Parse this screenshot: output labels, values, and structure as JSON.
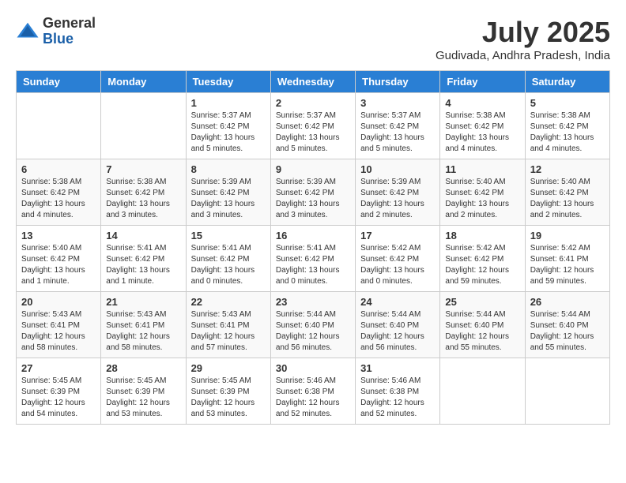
{
  "header": {
    "logo_general": "General",
    "logo_blue": "Blue",
    "month_title": "July 2025",
    "location": "Gudivada, Andhra Pradesh, India"
  },
  "weekdays": [
    "Sunday",
    "Monday",
    "Tuesday",
    "Wednesday",
    "Thursday",
    "Friday",
    "Saturday"
  ],
  "weeks": [
    [
      {
        "day": "",
        "sunrise": "",
        "sunset": "",
        "daylight": ""
      },
      {
        "day": "",
        "sunrise": "",
        "sunset": "",
        "daylight": ""
      },
      {
        "day": "1",
        "sunrise": "Sunrise: 5:37 AM",
        "sunset": "Sunset: 6:42 PM",
        "daylight": "Daylight: 13 hours and 5 minutes."
      },
      {
        "day": "2",
        "sunrise": "Sunrise: 5:37 AM",
        "sunset": "Sunset: 6:42 PM",
        "daylight": "Daylight: 13 hours and 5 minutes."
      },
      {
        "day": "3",
        "sunrise": "Sunrise: 5:37 AM",
        "sunset": "Sunset: 6:42 PM",
        "daylight": "Daylight: 13 hours and 5 minutes."
      },
      {
        "day": "4",
        "sunrise": "Sunrise: 5:38 AM",
        "sunset": "Sunset: 6:42 PM",
        "daylight": "Daylight: 13 hours and 4 minutes."
      },
      {
        "day": "5",
        "sunrise": "Sunrise: 5:38 AM",
        "sunset": "Sunset: 6:42 PM",
        "daylight": "Daylight: 13 hours and 4 minutes."
      }
    ],
    [
      {
        "day": "6",
        "sunrise": "Sunrise: 5:38 AM",
        "sunset": "Sunset: 6:42 PM",
        "daylight": "Daylight: 13 hours and 4 minutes."
      },
      {
        "day": "7",
        "sunrise": "Sunrise: 5:38 AM",
        "sunset": "Sunset: 6:42 PM",
        "daylight": "Daylight: 13 hours and 3 minutes."
      },
      {
        "day": "8",
        "sunrise": "Sunrise: 5:39 AM",
        "sunset": "Sunset: 6:42 PM",
        "daylight": "Daylight: 13 hours and 3 minutes."
      },
      {
        "day": "9",
        "sunrise": "Sunrise: 5:39 AM",
        "sunset": "Sunset: 6:42 PM",
        "daylight": "Daylight: 13 hours and 3 minutes."
      },
      {
        "day": "10",
        "sunrise": "Sunrise: 5:39 AM",
        "sunset": "Sunset: 6:42 PM",
        "daylight": "Daylight: 13 hours and 2 minutes."
      },
      {
        "day": "11",
        "sunrise": "Sunrise: 5:40 AM",
        "sunset": "Sunset: 6:42 PM",
        "daylight": "Daylight: 13 hours and 2 minutes."
      },
      {
        "day": "12",
        "sunrise": "Sunrise: 5:40 AM",
        "sunset": "Sunset: 6:42 PM",
        "daylight": "Daylight: 13 hours and 2 minutes."
      }
    ],
    [
      {
        "day": "13",
        "sunrise": "Sunrise: 5:40 AM",
        "sunset": "Sunset: 6:42 PM",
        "daylight": "Daylight: 13 hours and 1 minute."
      },
      {
        "day": "14",
        "sunrise": "Sunrise: 5:41 AM",
        "sunset": "Sunset: 6:42 PM",
        "daylight": "Daylight: 13 hours and 1 minute."
      },
      {
        "day": "15",
        "sunrise": "Sunrise: 5:41 AM",
        "sunset": "Sunset: 6:42 PM",
        "daylight": "Daylight: 13 hours and 0 minutes."
      },
      {
        "day": "16",
        "sunrise": "Sunrise: 5:41 AM",
        "sunset": "Sunset: 6:42 PM",
        "daylight": "Daylight: 13 hours and 0 minutes."
      },
      {
        "day": "17",
        "sunrise": "Sunrise: 5:42 AM",
        "sunset": "Sunset: 6:42 PM",
        "daylight": "Daylight: 13 hours and 0 minutes."
      },
      {
        "day": "18",
        "sunrise": "Sunrise: 5:42 AM",
        "sunset": "Sunset: 6:42 PM",
        "daylight": "Daylight: 12 hours and 59 minutes."
      },
      {
        "day": "19",
        "sunrise": "Sunrise: 5:42 AM",
        "sunset": "Sunset: 6:41 PM",
        "daylight": "Daylight: 12 hours and 59 minutes."
      }
    ],
    [
      {
        "day": "20",
        "sunrise": "Sunrise: 5:43 AM",
        "sunset": "Sunset: 6:41 PM",
        "daylight": "Daylight: 12 hours and 58 minutes."
      },
      {
        "day": "21",
        "sunrise": "Sunrise: 5:43 AM",
        "sunset": "Sunset: 6:41 PM",
        "daylight": "Daylight: 12 hours and 58 minutes."
      },
      {
        "day": "22",
        "sunrise": "Sunrise: 5:43 AM",
        "sunset": "Sunset: 6:41 PM",
        "daylight": "Daylight: 12 hours and 57 minutes."
      },
      {
        "day": "23",
        "sunrise": "Sunrise: 5:44 AM",
        "sunset": "Sunset: 6:40 PM",
        "daylight": "Daylight: 12 hours and 56 minutes."
      },
      {
        "day": "24",
        "sunrise": "Sunrise: 5:44 AM",
        "sunset": "Sunset: 6:40 PM",
        "daylight": "Daylight: 12 hours and 56 minutes."
      },
      {
        "day": "25",
        "sunrise": "Sunrise: 5:44 AM",
        "sunset": "Sunset: 6:40 PM",
        "daylight": "Daylight: 12 hours and 55 minutes."
      },
      {
        "day": "26",
        "sunrise": "Sunrise: 5:44 AM",
        "sunset": "Sunset: 6:40 PM",
        "daylight": "Daylight: 12 hours and 55 minutes."
      }
    ],
    [
      {
        "day": "27",
        "sunrise": "Sunrise: 5:45 AM",
        "sunset": "Sunset: 6:39 PM",
        "daylight": "Daylight: 12 hours and 54 minutes."
      },
      {
        "day": "28",
        "sunrise": "Sunrise: 5:45 AM",
        "sunset": "Sunset: 6:39 PM",
        "daylight": "Daylight: 12 hours and 53 minutes."
      },
      {
        "day": "29",
        "sunrise": "Sunrise: 5:45 AM",
        "sunset": "Sunset: 6:39 PM",
        "daylight": "Daylight: 12 hours and 53 minutes."
      },
      {
        "day": "30",
        "sunrise": "Sunrise: 5:46 AM",
        "sunset": "Sunset: 6:38 PM",
        "daylight": "Daylight: 12 hours and 52 minutes."
      },
      {
        "day": "31",
        "sunrise": "Sunrise: 5:46 AM",
        "sunset": "Sunset: 6:38 PM",
        "daylight": "Daylight: 12 hours and 52 minutes."
      },
      {
        "day": "",
        "sunrise": "",
        "sunset": "",
        "daylight": ""
      },
      {
        "day": "",
        "sunrise": "",
        "sunset": "",
        "daylight": ""
      }
    ]
  ]
}
